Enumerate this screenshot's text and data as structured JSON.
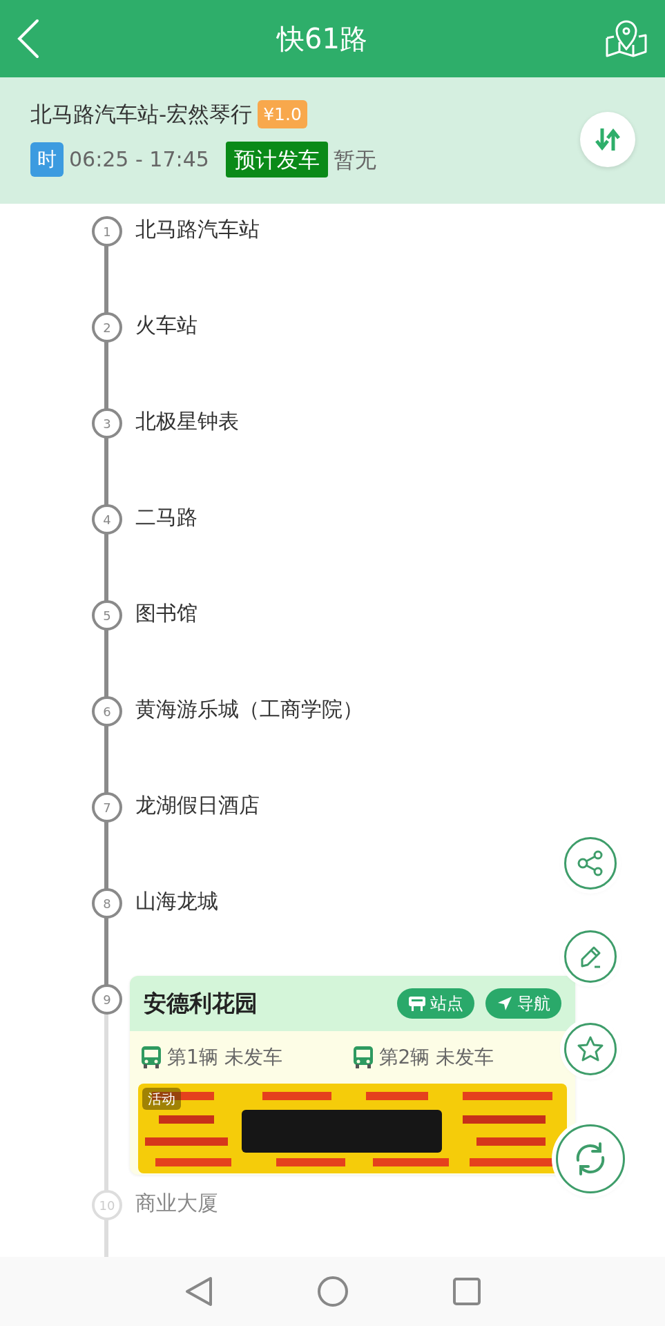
{
  "header": {
    "title": "快61路"
  },
  "route": {
    "name": "北马路汽车站-宏然琴行",
    "fare": "¥1.0",
    "time_label": "时",
    "hours": "06:25 - 17:45",
    "departure_label": "预计发车",
    "departure": "暂无"
  },
  "stations": [
    {
      "number": "1",
      "name": "北马路汽车站",
      "selected": false,
      "faded": false
    },
    {
      "number": "2",
      "name": "火车站",
      "selected": false,
      "faded": false
    },
    {
      "number": "3",
      "name": "北极星钟表",
      "selected": false,
      "faded": false
    },
    {
      "number": "4",
      "name": "二马路",
      "selected": false,
      "faded": false
    },
    {
      "number": "5",
      "name": "图书馆",
      "selected": false,
      "faded": false
    },
    {
      "number": "6",
      "name": "黄海游乐城（工商学院）",
      "selected": false,
      "faded": false
    },
    {
      "number": "7",
      "name": "龙湖假日酒店",
      "selected": false,
      "faded": false
    },
    {
      "number": "8",
      "name": "山海龙城",
      "selected": false,
      "faded": false
    },
    {
      "number": "9",
      "name": "安德利花园",
      "selected": true,
      "faded": false
    },
    {
      "number": "10",
      "name": "商业大厦",
      "selected": false,
      "faded": true
    }
  ],
  "station_card": {
    "buttons": [
      {
        "kind": "stop",
        "label": "站点"
      },
      {
        "kind": "navigate",
        "label": "导航"
      }
    ],
    "buses": [
      {
        "label": "第1辆 未发车"
      },
      {
        "label": "第2辆 未发车"
      }
    ],
    "ad": {
      "kind": "picture",
      "badge": "活动"
    }
  }
}
